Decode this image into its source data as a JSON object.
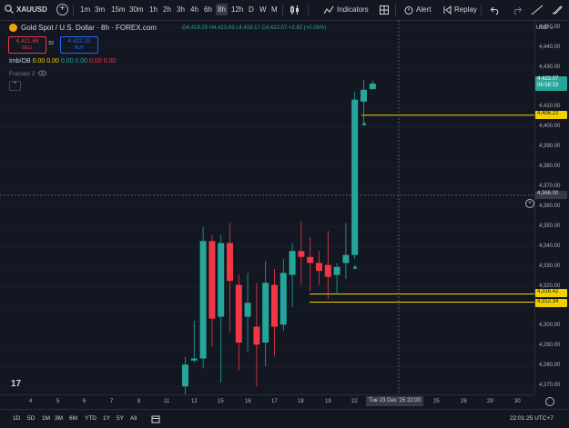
{
  "toolbar": {
    "symbol": "XAUUSD",
    "intervals": [
      "1m",
      "3m",
      "15m",
      "30m",
      "1h",
      "2h",
      "3h",
      "4h",
      "6h",
      "8h",
      "12h",
      "D",
      "W",
      "M"
    ],
    "active_interval": "8h",
    "indicators_label": "Indicators",
    "alert_label": "Alert",
    "replay_label": "Replay"
  },
  "legend": {
    "title": "Gold Spot / U.S. Dollar · 8h · FOREX.com",
    "ohlc": {
      "o_label": "O",
      "o": "4,419.25",
      "h_label": "H",
      "h": "4,423.63",
      "l_label": "L",
      "l": "4,419.17",
      "c_label": "C",
      "c": "4,422.07",
      "change": "+2.82 (+0.06%)"
    },
    "sell_price": "4,421.68",
    "sell_label": "SELL",
    "spread": "32",
    "buy_price": "4,422.20",
    "buy_label": "BUY",
    "imb_label": "Imb/OB",
    "imb_values": [
      "0.00",
      "0.00",
      "0.00",
      "0.00",
      "0.00",
      "0.00"
    ],
    "fractals_label": "Fractals 2"
  },
  "currency": "USD",
  "price_labels": {
    "last": "4,422.07",
    "countdown": "06:58:33",
    "line_upper": "4,406.22",
    "crosshair": "4,366.00",
    "line_mid": "4,316.42",
    "line_low": "4,312.34"
  },
  "x_crosshair_label": "Tue 23 Dec '25   22:00",
  "bottom": {
    "ranges": [
      "1D",
      "5D",
      "1M",
      "3M",
      "6M",
      "YTD",
      "1Y",
      "5Y",
      "All"
    ],
    "clock": "22:01:25 UTC+7"
  },
  "colors": {
    "up": "#26a69a",
    "down": "#f23645",
    "level": "#f0d000",
    "bg": "#131722"
  },
  "chart_data": {
    "type": "candlestick",
    "y_ticks": [
      4450,
      4440,
      4430,
      4420,
      4410,
      4400,
      4390,
      4380,
      4370,
      4360,
      4350,
      4340,
      4330,
      4320,
      4310,
      4300,
      4290,
      4280,
      4270
    ],
    "ylim": [
      4266,
      4454
    ],
    "x_ticks": [
      "4",
      "5",
      "6",
      "7",
      "8",
      "11",
      "12",
      "15",
      "16",
      "17",
      "18",
      "19",
      "22",
      "25",
      "26",
      "29",
      "30"
    ],
    "horizontal_levels": [
      4406.22,
      4316.42,
      4312.34
    ],
    "crosshair_y": 4366.0,
    "candles": [
      {
        "o": 4270,
        "h": 4285,
        "l": 4262,
        "c": 4281
      },
      {
        "o": 4283,
        "h": 4303,
        "l": 4282,
        "c": 4284
      },
      {
        "o": 4284,
        "h": 4350,
        "l": 4279,
        "c": 4343
      },
      {
        "o": 4343,
        "h": 4346,
        "l": 4290,
        "c": 4304
      },
      {
        "o": 4305,
        "h": 4346,
        "l": 4272,
        "c": 4342
      },
      {
        "o": 4342,
        "h": 4352,
        "l": 4297,
        "c": 4323
      },
      {
        "o": 4321,
        "h": 4326,
        "l": 4278,
        "c": 4292
      },
      {
        "o": 4305,
        "h": 4327,
        "l": 4287,
        "c": 4312
      },
      {
        "o": 4300,
        "h": 4322,
        "l": 4270,
        "c": 4291
      },
      {
        "o": 4292,
        "h": 4333,
        "l": 4280,
        "c": 4322
      },
      {
        "o": 4321,
        "h": 4329,
        "l": 4285,
        "c": 4300
      },
      {
        "o": 4301,
        "h": 4334,
        "l": 4298,
        "c": 4327
      },
      {
        "o": 4326,
        "h": 4342,
        "l": 4310,
        "c": 4338
      },
      {
        "o": 4338,
        "h": 4353,
        "l": 4321,
        "c": 4335
      },
      {
        "o": 4335,
        "h": 4345,
        "l": 4318,
        "c": 4332
      },
      {
        "o": 4332,
        "h": 4338,
        "l": 4321,
        "c": 4328
      },
      {
        "o": 4331,
        "h": 4348,
        "l": 4314,
        "c": 4325
      },
      {
        "o": 4326,
        "h": 4332,
        "l": 4316,
        "c": 4330
      },
      {
        "o": 4332,
        "h": 4352,
        "l": 4324,
        "c": 4336
      },
      {
        "o": 4336,
        "h": 4418,
        "l": 4334,
        "c": 4414
      },
      {
        "o": 4413,
        "h": 4424,
        "l": 4402,
        "c": 4419
      },
      {
        "o": 4419.25,
        "h": 4423.63,
        "l": 4419.17,
        "c": 4422.07
      }
    ]
  }
}
